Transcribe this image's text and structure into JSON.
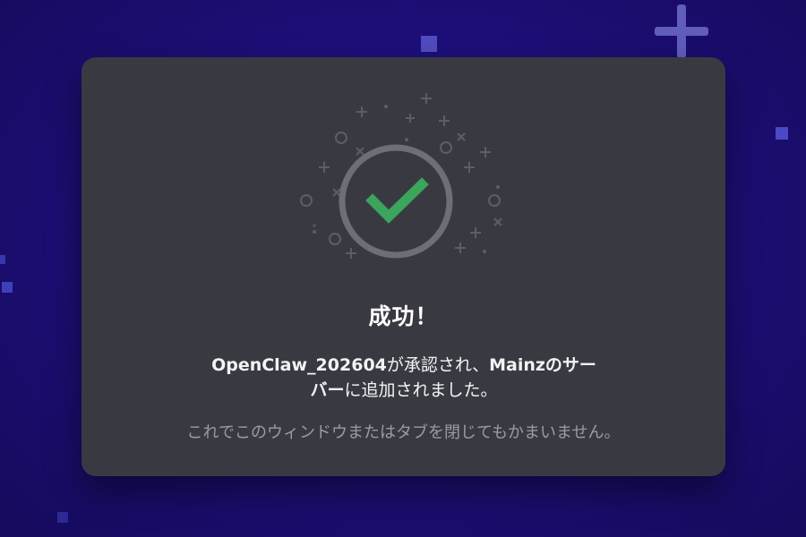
{
  "dialog": {
    "title": "成功！",
    "bot_name": "OpenClaw_202604",
    "message_part1": "が承認され、",
    "server_name": "Mainzのサーバー",
    "message_part2": "に追加されました。",
    "close_hint": "これでこのウィンドウまたはタブを閉じてもかまいません。"
  },
  "icons": {
    "status": "success-checkmark-icon"
  },
  "colors": {
    "background": "#1d0f7a",
    "modal": "#393a41",
    "check": "#3ba55c",
    "ring": "#6d6f78"
  }
}
